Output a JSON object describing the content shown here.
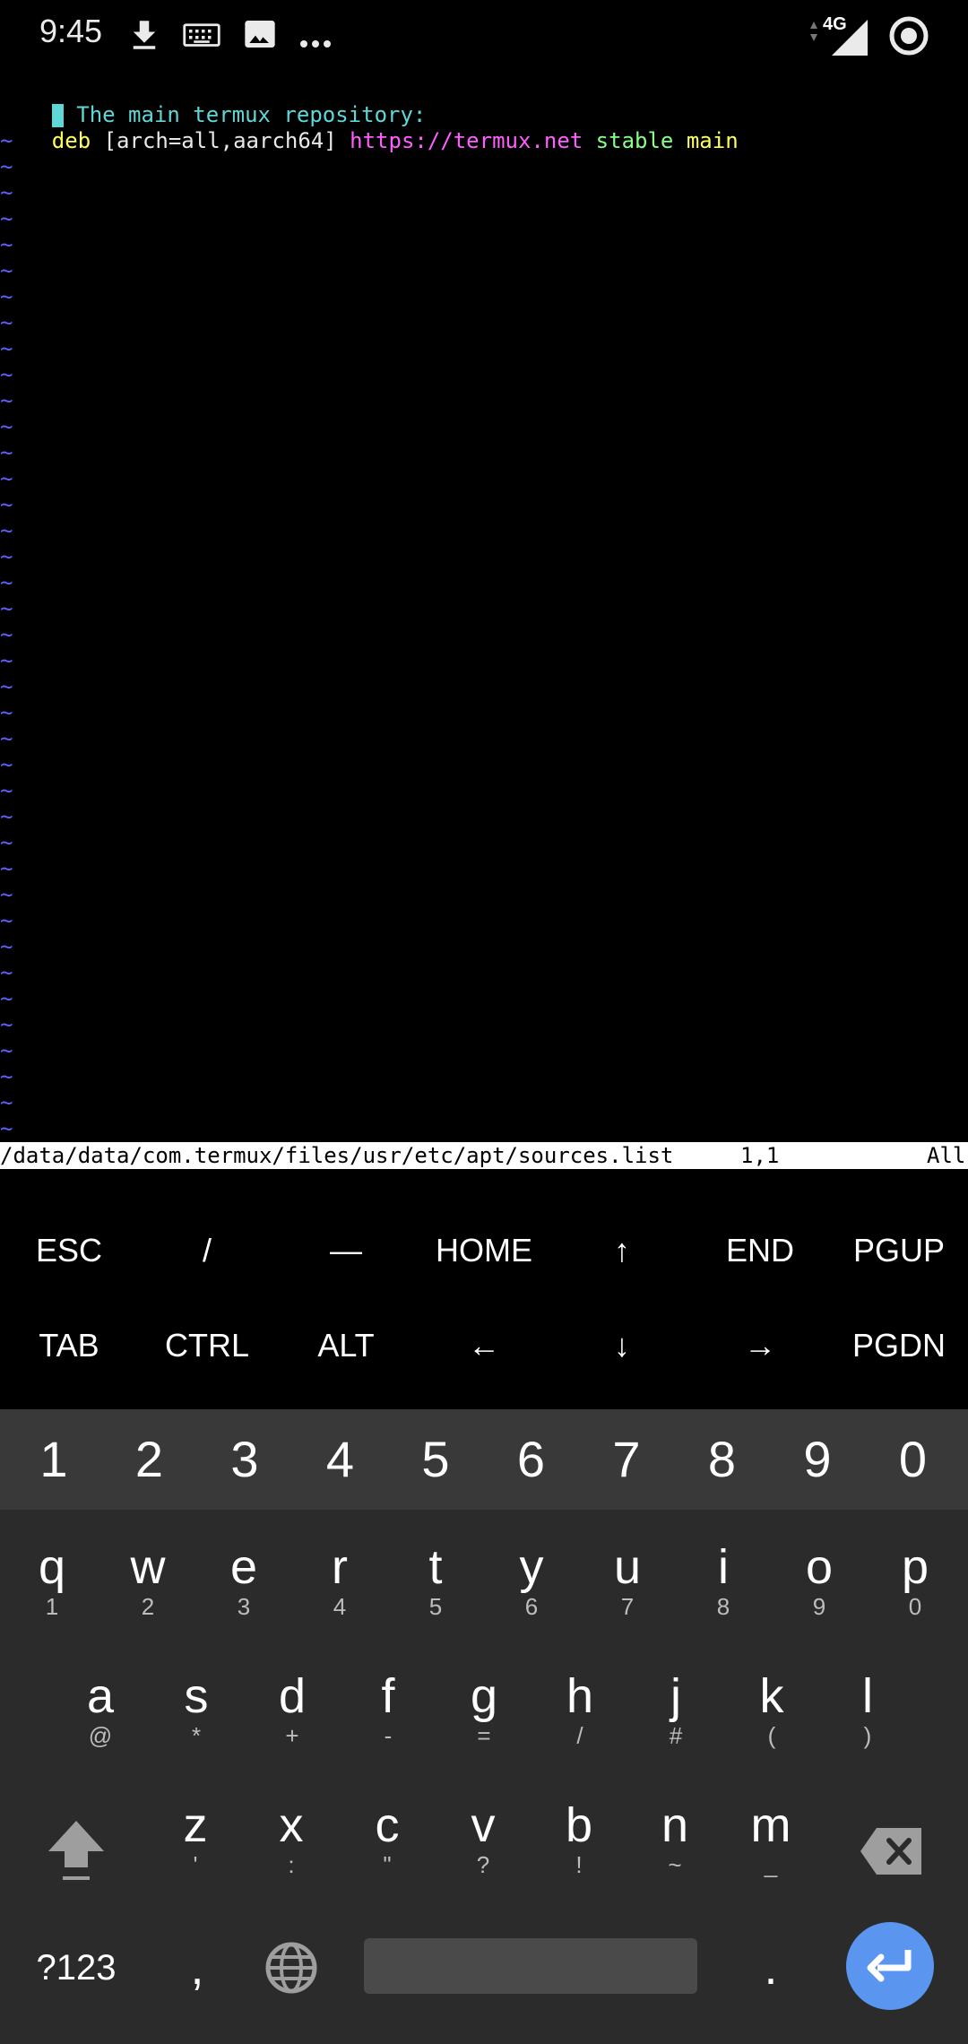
{
  "status_bar": {
    "time": "9:45",
    "network": "4G",
    "icons": [
      "download-icon",
      "keyboard-icon",
      "image-icon",
      "more-icon",
      "signal-icon",
      "sync-icon"
    ]
  },
  "editor": {
    "line1_comment": " The main termux repository:",
    "line2": {
      "deb": "deb",
      "opts": " [arch=all,aarch64] ",
      "url": "https://termux.net",
      "suite": " stable",
      "component": " main"
    },
    "tilde": "~",
    "status_path": "/data/data/com.termux/files/usr/etc/apt/sources.list",
    "status_pos": "1,1",
    "status_view": "All"
  },
  "extra_keys": {
    "row1": [
      "ESC",
      "/",
      "—",
      "HOME",
      "↑",
      "END",
      "PGUP"
    ],
    "row2": [
      "TAB",
      "CTRL",
      "ALT",
      "←",
      "↓",
      "→",
      "PGDN"
    ]
  },
  "keyboard": {
    "numbers": [
      "1",
      "2",
      "3",
      "4",
      "5",
      "6",
      "7",
      "8",
      "9",
      "0"
    ],
    "row_q": [
      {
        "k": "q",
        "s": "1"
      },
      {
        "k": "w",
        "s": "2"
      },
      {
        "k": "e",
        "s": "3"
      },
      {
        "k": "r",
        "s": "4"
      },
      {
        "k": "t",
        "s": "5"
      },
      {
        "k": "y",
        "s": "6"
      },
      {
        "k": "u",
        "s": "7"
      },
      {
        "k": "i",
        "s": "8"
      },
      {
        "k": "o",
        "s": "9"
      },
      {
        "k": "p",
        "s": "0"
      }
    ],
    "row_a": [
      {
        "k": "a",
        "s": "@"
      },
      {
        "k": "s",
        "s": "*"
      },
      {
        "k": "d",
        "s": "+"
      },
      {
        "k": "f",
        "s": "-"
      },
      {
        "k": "g",
        "s": "="
      },
      {
        "k": "h",
        "s": "/"
      },
      {
        "k": "j",
        "s": "#"
      },
      {
        "k": "k",
        "s": "("
      },
      {
        "k": "l",
        "s": ")"
      }
    ],
    "row_z": [
      {
        "k": "z",
        "s": "'"
      },
      {
        "k": "x",
        "s": ":"
      },
      {
        "k": "c",
        "s": "\""
      },
      {
        "k": "v",
        "s": "?"
      },
      {
        "k": "b",
        "s": "!"
      },
      {
        "k": "n",
        "s": "~"
      },
      {
        "k": "m",
        "s": "_"
      }
    ],
    "symbols_label": "?123",
    "comma": ",",
    "period": "."
  },
  "colors": {
    "cyan": "#5fd7d7",
    "yellow": "#ffff5f",
    "magenta": "#ff5fff",
    "green": "#87ff87",
    "tilde_blue": "#5f5fff",
    "enter_blue": "#5a95f0"
  }
}
